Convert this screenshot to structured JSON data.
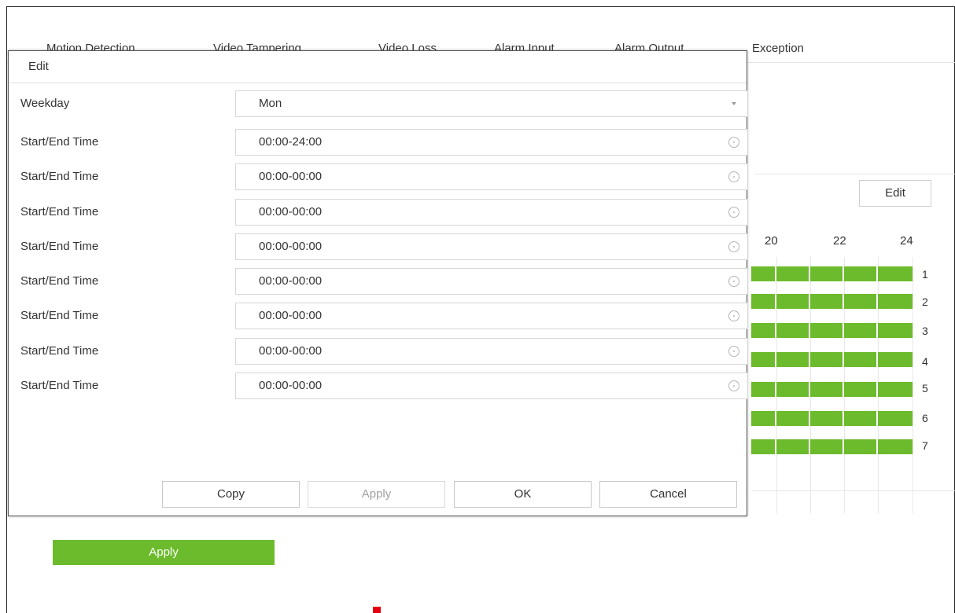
{
  "tabs": [
    "Motion Detection",
    "Video Tampering",
    "Video Loss",
    "Alarm Input",
    "Alarm Output",
    "Exception"
  ],
  "background": {
    "edit_button": "Edit",
    "hour_labels": [
      "20",
      "22",
      "24"
    ],
    "day_numbers": [
      "1",
      "2",
      "3",
      "4",
      "5",
      "6",
      "7"
    ],
    "apply_button": "Apply",
    "accent_color": "#6cbb2c"
  },
  "dialog": {
    "title": "Edit",
    "weekday": {
      "label": "Weekday",
      "value": "Mon"
    },
    "time_rows": [
      {
        "label": "Start/End Time",
        "value": "00:00-24:00"
      },
      {
        "label": "Start/End Time",
        "value": "00:00-00:00"
      },
      {
        "label": "Start/End Time",
        "value": "00:00-00:00"
      },
      {
        "label": "Start/End Time",
        "value": "00:00-00:00"
      },
      {
        "label": "Start/End Time",
        "value": "00:00-00:00"
      },
      {
        "label": "Start/End Time",
        "value": "00:00-00:00"
      },
      {
        "label": "Start/End Time",
        "value": "00:00-00:00"
      },
      {
        "label": "Start/End Time",
        "value": "00:00-00:00"
      }
    ],
    "buttons": {
      "copy": "Copy",
      "apply": "Apply",
      "ok": "OK",
      "cancel": "Cancel"
    }
  }
}
